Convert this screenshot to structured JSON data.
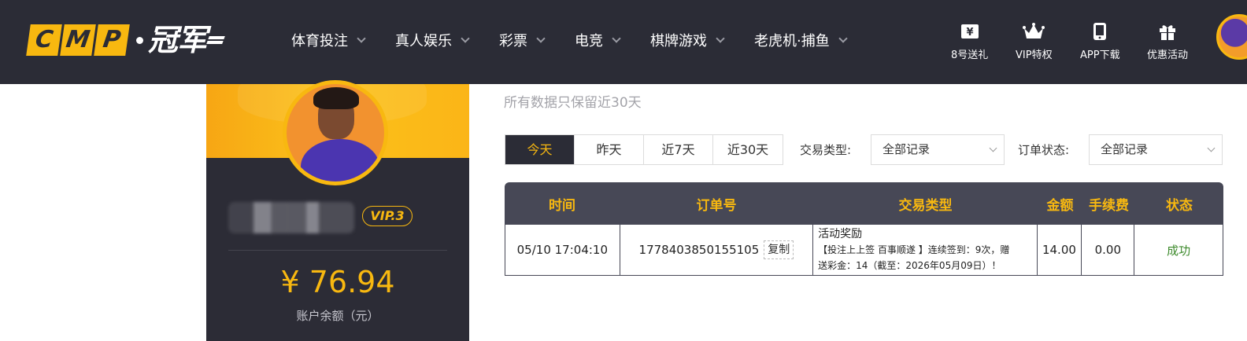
{
  "logo": {
    "letters": [
      "C",
      "M",
      "P"
    ],
    "cn": "冠军"
  },
  "nav": [
    {
      "label": "体育投注"
    },
    {
      "label": "真人娱乐"
    },
    {
      "label": "彩票"
    },
    {
      "label": "电竞"
    },
    {
      "label": "棋牌游戏"
    },
    {
      "label": "老虎机·捕鱼"
    }
  ],
  "quick_links": [
    {
      "label": "8号送礼",
      "icon": "gift-coupon-icon"
    },
    {
      "label": "VIP特权",
      "icon": "crown-icon"
    },
    {
      "label": "APP下载",
      "icon": "phone-icon"
    },
    {
      "label": "优惠活动",
      "icon": "gift-box-icon"
    }
  ],
  "profile": {
    "vip_level": "VIP.3",
    "balance": "¥ 76.94",
    "balance_label": "账户余额（元）"
  },
  "notice": "所有数据只保留近30天",
  "date_tabs": [
    {
      "label": "今天",
      "active": true
    },
    {
      "label": "昨天",
      "active": false
    },
    {
      "label": "近7天",
      "active": false
    },
    {
      "label": "近30天",
      "active": false
    }
  ],
  "filters": {
    "type_label": "交易类型:",
    "type_value": "全部记录",
    "status_label": "订单状态:",
    "status_value": "全部记录"
  },
  "table": {
    "headers": [
      "时间",
      "订单号",
      "交易类型",
      "金额",
      "手续费",
      "状态"
    ],
    "rows": [
      {
        "time": "05/10 17:04:10",
        "order_no": "1778403850155105",
        "copy_label": "复制",
        "type_title": "活动奖励",
        "type_detail_1": "【投注上上签 百事顺遂 】连续签到：9次，赠",
        "type_detail_2": "送彩金：14（截至：2026年05月09日）！",
        "amount": "14.00",
        "fee": "0.00",
        "status": "成功"
      }
    ]
  },
  "colors": {
    "accent": "#f8b810",
    "dark": "#2b2c36",
    "table_header": "#474856",
    "success": "#3d8a2c"
  }
}
